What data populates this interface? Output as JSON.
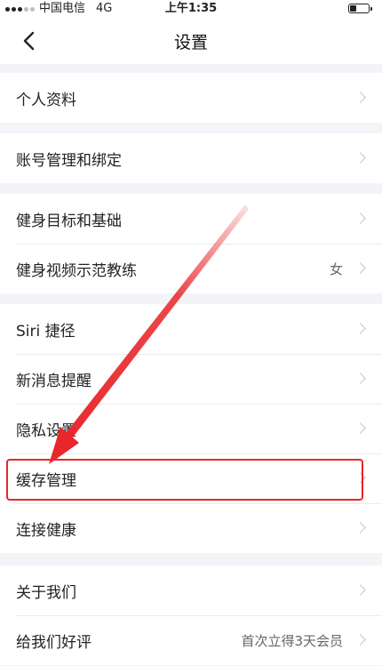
{
  "status_bar": {
    "carrier": "中国电信",
    "network": "4G",
    "time": "上午1:35"
  },
  "nav": {
    "back_icon": "chevron-left-icon",
    "title": "设置"
  },
  "groups": [
    {
      "items": [
        {
          "label": "个人资料"
        }
      ]
    },
    {
      "items": [
        {
          "label": "账号管理和绑定"
        }
      ]
    },
    {
      "items": [
        {
          "label": "健身目标和基础"
        },
        {
          "label": "健身视频示范教练",
          "value": "女"
        }
      ]
    },
    {
      "items": [
        {
          "label": "Siri 捷径"
        },
        {
          "label": "新消息提醒"
        },
        {
          "label": "隐私设置"
        },
        {
          "label": "缓存管理"
        },
        {
          "label": "连接健康"
        }
      ]
    },
    {
      "items": [
        {
          "label": "关于我们"
        },
        {
          "label": "给我们好评",
          "value": "首次立得3天会员"
        }
      ]
    }
  ],
  "annotation": {
    "color": "#e8262b",
    "highlighted_item": "缓存管理"
  }
}
